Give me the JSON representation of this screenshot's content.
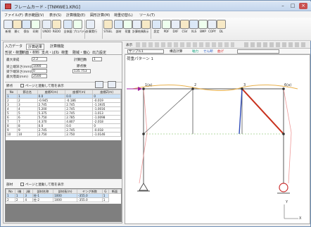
{
  "window": {
    "title": "フレームカード - [TNMWE1.KRG]"
  },
  "menu": [
    "ファイル(F)",
    "表示範囲(V)",
    "表示(S)",
    "計算機能(E)",
    "図形計算(M)",
    "荷重切替(L)",
    "ツール(T)"
  ],
  "toolbar": [
    "新規",
    "開く",
    "保存",
    "印刷",
    "UNDO",
    "REDO",
    "全体図",
    "プロパティ",
    "計算実行",
    "STEEL",
    "部材",
    "荷重",
    "計算結果",
    "表示",
    "設定",
    "PDF",
    "DXF",
    "CSV",
    "XLS",
    "BMP",
    "COPY",
    "DL"
  ],
  "left": {
    "tabs": [
      "入力データ",
      "計算結果",
      "計算機能"
    ],
    "subtabs": [
      "形状・荷重",
      "断面・材料",
      "支点・ばね",
      "荷重",
      "剛域・偏心",
      "出力設定"
    ],
    "params": [
      {
        "label": "最大梁成",
        "value": "2.2"
      },
      {
        "label": "梁上端深さ(mm)",
        "value": "1000"
      },
      {
        "label": "梁下端深さ(mm)",
        "value": "0"
      },
      {
        "label": "最大階高(mm)",
        "value": "2500"
      }
    ],
    "right_params": [
      {
        "label": "計算回数",
        "value": "1"
      },
      {
        "label": "節点数",
        "value": ""
      },
      {
        "label": "",
        "value": "135.753"
      }
    ],
    "grid_title": "節点",
    "check_label": "ページと連動して階を表示",
    "node_cols": [
      "No",
      "節点名",
      "座標X(m)",
      "座標Y(m)",
      "座標Z(m)"
    ],
    "nodes": [
      [
        "1",
        "1",
        "0.0",
        "0.0",
        "0"
      ],
      [
        "2",
        "2",
        "-0.945",
        "-0.186",
        "-0.019"
      ],
      [
        "3",
        "3",
        "2.745",
        "2.745",
        "-1.1935"
      ],
      [
        "4",
        "4",
        "5.200",
        "2.745",
        "-1.0016"
      ],
      [
        "5",
        "5",
        "5.375",
        "2.745",
        "-1.013"
      ],
      [
        "6",
        "6",
        "5.750",
        "2.785",
        "-1.0098"
      ],
      [
        "7",
        "7",
        "4.370",
        "4.807",
        "-2.018"
      ],
      [
        "8",
        "8",
        "0.0",
        "0.0",
        "0"
      ],
      [
        "9",
        "9",
        "2.745",
        "2.745",
        "-0.018"
      ],
      [
        "10",
        "10",
        "2.750",
        "2.750",
        "-1.0146"
      ]
    ],
    "bottom_title": "部材",
    "bottom_check": "ページと連動して階を表示",
    "member_cols": [
      "No",
      "i端",
      "j端",
      "部材名称",
      "部材長(m)",
      "ヤング係数",
      "G",
      "断面"
    ],
    "members": [
      [
        "1",
        "1",
        "3",
        "柱-1",
        "1000",
        "-355.0",
        "1"
      ],
      [
        "2",
        "2",
        "4",
        "柱-2",
        "1000",
        "-355.0",
        "1"
      ]
    ]
  },
  "right": {
    "toolbar_label": "表示",
    "page_label": "サンプル1",
    "display_mode": "構造計算",
    "legend_items": [
      "軸力",
      "せん断",
      "曲げ"
    ],
    "canvas_title": "荷重パターン 1",
    "node_labels": [
      "1(a)",
      "2",
      "3",
      "6(a)"
    ],
    "axis_labels": [
      "Y",
      "X"
    ]
  }
}
